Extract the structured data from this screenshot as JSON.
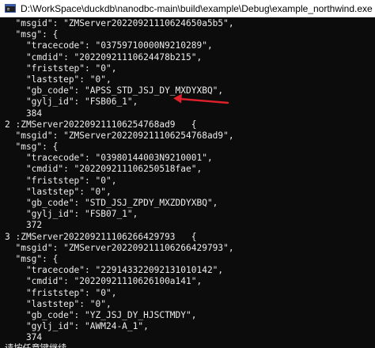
{
  "window": {
    "title": "D:\\WorkSpace\\duckdb\\nanodbc-main\\build\\example\\Debug\\example_northwind.exe",
    "app_icon": "console-icon"
  },
  "console": {
    "lines": [
      "  \"msgid\": \"ZMServer20220921110624650a5b5\",",
      "  \"msg\": {",
      "    \"tracecode\": \"03759710000N9210289\",",
      "    \"cmdid\": \"20220921110624478b215\",",
      "    \"friststep\": \"0\",",
      "    \"laststep\": \"0\",",
      "    \"gb_code\": \"APSS_STD_JSJ_DY_MXDYXBQ\",",
      "    \"gylj_id\": \"FSB06_1\",",
      "    384",
      "2 :ZMServer20220921110625476​8ad9   {",
      "  \"msgid\": \"ZMServer20220921110625476​8ad9\",",
      "  \"msg\": {",
      "    \"tracecode\": \"03980144003N9210001\",",
      "    \"cmdid\": \"20220921110625051​8fae\",",
      "    \"friststep\": \"0\",",
      "    \"laststep\": \"0\",",
      "    \"gb_code\": \"STD_JSJ_ZPDY_MXZDDYXBQ\",",
      "    \"gylj_id\": \"FSB07_1\",",
      "    372",
      "3 :ZMServer20220921110626642​9793   {",
      "  \"msgid\": \"ZMServer20220921110626642​9793\",",
      "  \"msg\": {",
      "    \"tracecode\": \"22914332209213101014​2\",",
      "    \"cmdid\": \"20220921110626100a141\",",
      "    \"friststep\": \"0\",",
      "    \"laststep\": \"0\",",
      "    \"gb_code\": \"YZ_JSJ_DY_HJSCTMDY\",",
      "    \"gylj_id\": \"AWM24-A_1\",",
      "    374",
      "请按任意键继续. . ."
    ]
  },
  "annotation": {
    "icon": "red-arrow-icon",
    "color": "#e0202a"
  }
}
